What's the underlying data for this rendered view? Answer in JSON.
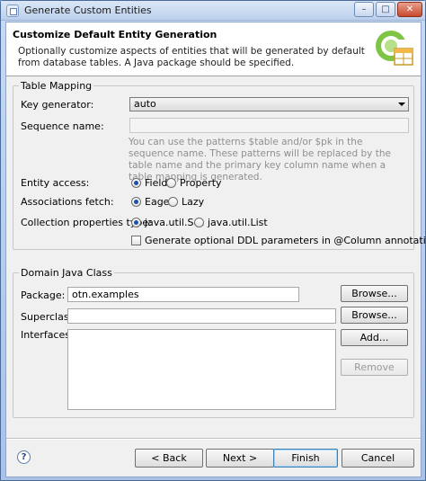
{
  "window": {
    "title": "Generate Custom Entities",
    "minimize": "–",
    "maximize": "□",
    "close": "✕"
  },
  "header": {
    "title": "Customize Default Entity Generation",
    "description": "Optionally customize aspects of entities that will be generated by default from database tables. A Java package should be specified.",
    "logo_icon": "wizard-banner-icon"
  },
  "table_mapping": {
    "group_label": "Table Mapping",
    "key_generator_label": "Key generator:",
    "key_generator_value": "auto",
    "sequence_name_label": "Sequence name:",
    "sequence_name_value": "",
    "sequence_hint": "You can use the patterns $table and/or $pk in the sequence name. These patterns will be replaced by the table name and the primary key column name when a table mapping is generated.",
    "entity_access_label": "Entity access:",
    "entity_access_options": [
      "Field",
      "Property"
    ],
    "entity_access_selected": "Field",
    "associations_fetch_label": "Associations fetch:",
    "associations_fetch_options": [
      "Eager",
      "Lazy"
    ],
    "associations_fetch_selected": "Eager",
    "collection_type_label": "Collection properties type:",
    "collection_type_options": [
      "java.util.Set",
      "java.util.List"
    ],
    "collection_type_selected": "java.util.Set",
    "ddl_checkbox_label": "Generate optional DDL parameters in @Column annotation",
    "ddl_checked": false
  },
  "domain_class": {
    "group_label": "Domain Java Class",
    "package_label": "Package:",
    "package_value": "otn.examples",
    "package_browse": "Browse...",
    "superclass_label": "Superclass:",
    "superclass_value": "",
    "superclass_browse": "Browse...",
    "interfaces_label": "Interfaces:",
    "add_button": "Add...",
    "remove_button": "Remove"
  },
  "footer": {
    "help": "?",
    "back": "< Back",
    "next": "Next >",
    "finish": "Finish",
    "cancel": "Cancel"
  }
}
